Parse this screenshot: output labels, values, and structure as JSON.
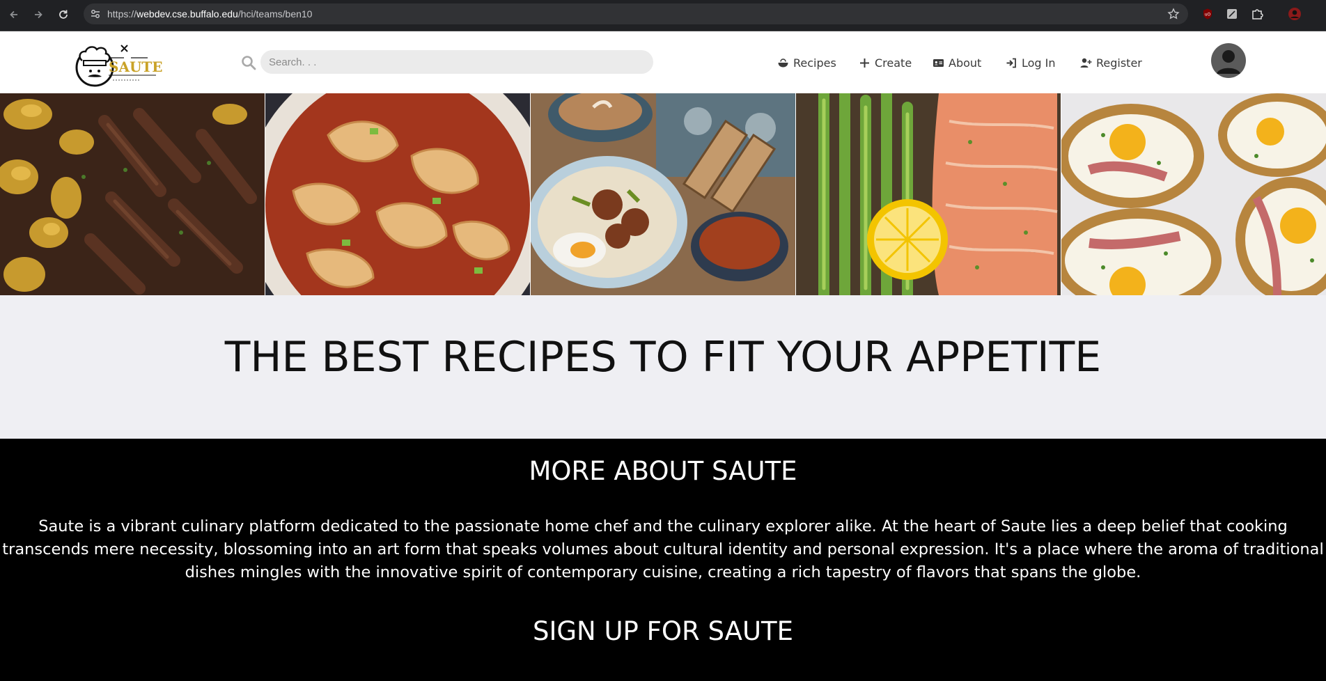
{
  "browser": {
    "url_scheme": "https://",
    "url_host": "webdev.cse.buffalo.edu",
    "url_path": "/hci/teams/ben10"
  },
  "header": {
    "logo_text": "SAUTE",
    "search_placeholder": "Search. . .",
    "nav": [
      {
        "label": "Recipes",
        "icon": "bowl-icon"
      },
      {
        "label": "Create",
        "icon": "plus-icon"
      },
      {
        "label": "About",
        "icon": "id-card-icon"
      },
      {
        "label": "Log In",
        "icon": "sign-in-icon"
      },
      {
        "label": "Register",
        "icon": "user-plus-icon"
      }
    ]
  },
  "hero": {
    "images": [
      {
        "name": "steak-potatoes-image"
      },
      {
        "name": "dumplings-chili-oil-image"
      },
      {
        "name": "breakfast-meatballs-coffee-image"
      },
      {
        "name": "salmon-asparagus-image"
      },
      {
        "name": "baked-egg-potatoes-image"
      }
    ]
  },
  "tagline": "THE BEST RECIPES TO FIT YOUR APPETITE",
  "about": {
    "title": "MORE ABOUT SAUTE",
    "body_lines": [
      "Saute is a vibrant culinary platform dedicated to the passionate home chef and the culinary explorer alike. At the heart of Saute lies a deep belief that cooking",
      "transcends mere necessity, blossoming into an art form that speaks volumes about cultural identity and personal expression. It's a place where the aroma of traditional",
      "dishes mingles with the innovative spirit of contemporary cuisine, creating a rich tapestry of flavors that spans the globe."
    ],
    "signup_title": "SIGN UP FOR SAUTE"
  },
  "colors": {
    "chrome_bg": "#202124",
    "header_bg": "#ffffff",
    "tagline_bg": "#efeff3",
    "about_bg": "#000000",
    "logo_gold": "#c9a227"
  }
}
